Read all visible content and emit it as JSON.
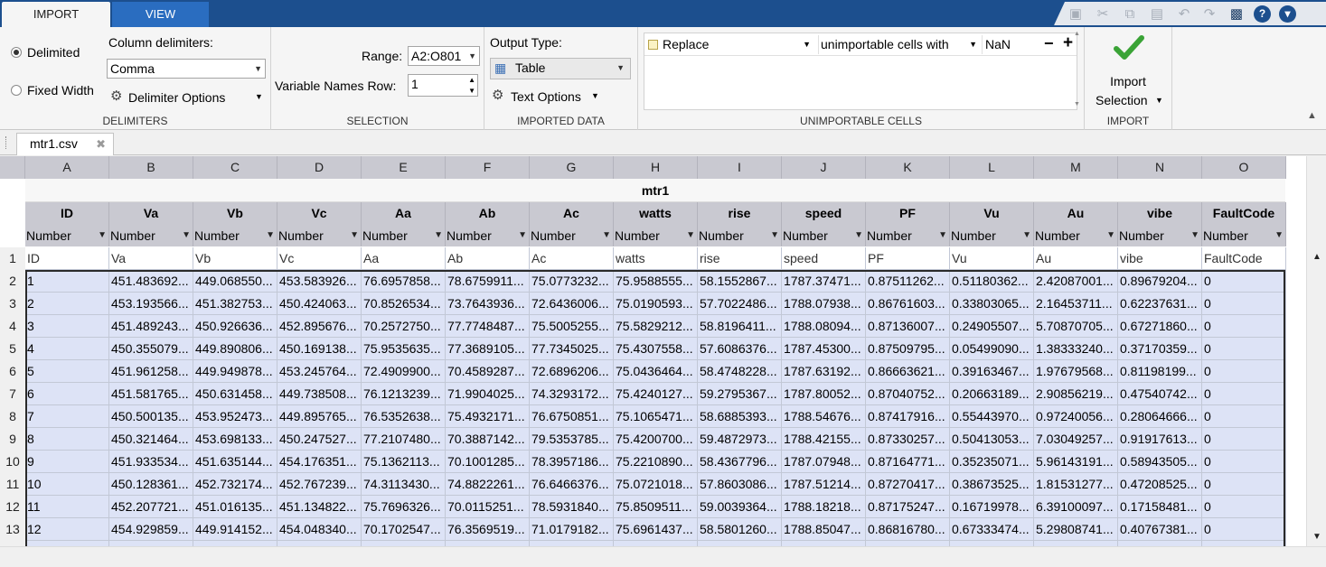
{
  "tabs": {
    "import": "IMPORT",
    "view": "VIEW"
  },
  "delimiters": {
    "delimited": "Delimited",
    "fixed_width": "Fixed Width",
    "column_delimiters_label": "Column delimiters:",
    "column_delimiter_value": "Comma",
    "delimiter_options": "Delimiter Options",
    "section_label": "DELIMITERS"
  },
  "selection": {
    "range_label": "Range:",
    "range_value": "A2:O801",
    "varnames_label": "Variable Names Row:",
    "varnames_value": "1",
    "section_label": "SELECTION"
  },
  "imported_data": {
    "output_type_label": "Output Type:",
    "output_type_value": "Table",
    "text_options": "Text Options",
    "section_label": "IMPORTED DATA"
  },
  "unimportable": {
    "rule_action": "Replace",
    "rule_target": "unimportable cells with",
    "rule_value": "NaN",
    "minus": "−",
    "plus": "+",
    "section_label": "UNIMPORTABLE CELLS"
  },
  "import_section": {
    "import_label": "Import",
    "selection_label": "Selection",
    "section_label": "IMPORT"
  },
  "doc_tab": {
    "label": "mtr1.csv"
  },
  "grid": {
    "column_letters": [
      "A",
      "B",
      "C",
      "D",
      "E",
      "F",
      "G",
      "H",
      "I",
      "J",
      "K",
      "L",
      "M",
      "N",
      "O"
    ],
    "table_name": "mtr1",
    "variable_names": [
      "ID",
      "Va",
      "Vb",
      "Vc",
      "Aa",
      "Ab",
      "Ac",
      "watts",
      "rise",
      "speed",
      "PF",
      "Vu",
      "Au",
      "vibe",
      "FaultCode"
    ],
    "type_label": "Number",
    "header_row": [
      "ID",
      "Va",
      "Vb",
      "Vc",
      "Aa",
      "Ab",
      "Ac",
      "watts",
      "rise",
      "speed",
      "PF",
      "Vu",
      "Au",
      "vibe",
      "FaultCode"
    ],
    "rows": [
      [
        "1",
        "451.483692...",
        "449.068550...",
        "453.583926...",
        "76.6957858...",
        "78.6759911...",
        "75.0773232...",
        "75.9588555...",
        "58.1552867...",
        "1787.37471...",
        "0.87511262...",
        "0.51180362...",
        "2.42087001...",
        "0.89679204...",
        "0"
      ],
      [
        "2",
        "453.193566...",
        "451.382753...",
        "450.424063...",
        "70.8526534...",
        "73.7643936...",
        "72.6436006...",
        "75.0190593...",
        "57.7022486...",
        "1788.07938...",
        "0.86761603...",
        "0.33803065...",
        "2.16453711...",
        "0.62237631...",
        "0"
      ],
      [
        "3",
        "451.489243...",
        "450.926636...",
        "452.895676...",
        "70.2572750...",
        "77.7748487...",
        "75.5005255...",
        "75.5829212...",
        "58.8196411...",
        "1788.08094...",
        "0.87136007...",
        "0.24905507...",
        "5.70870705...",
        "0.67271860...",
        "0"
      ],
      [
        "4",
        "450.355079...",
        "449.890806...",
        "450.169138...",
        "75.9535635...",
        "77.3689105...",
        "77.7345025...",
        "75.4307558...",
        "57.6086376...",
        "1787.45300...",
        "0.87509795...",
        "0.05499090...",
        "1.38333240...",
        "0.37170359...",
        "0"
      ],
      [
        "5",
        "451.961258...",
        "449.949878...",
        "453.245764...",
        "72.4909900...",
        "70.4589287...",
        "72.6896206...",
        "75.0436464...",
        "58.4748228...",
        "1787.63192...",
        "0.86663621...",
        "0.39163467...",
        "1.97679568...",
        "0.81198199...",
        "0"
      ],
      [
        "6",
        "451.581765...",
        "450.631458...",
        "449.738508...",
        "76.1213239...",
        "71.9904025...",
        "74.3293172...",
        "75.4240127...",
        "59.2795367...",
        "1787.80052...",
        "0.87040752...",
        "0.20663189...",
        "2.90856219...",
        "0.47540742...",
        "0"
      ],
      [
        "7",
        "450.500135...",
        "453.952473...",
        "449.895765...",
        "76.5352638...",
        "75.4932171...",
        "76.6750851...",
        "75.1065471...",
        "58.6885393...",
        "1788.54676...",
        "0.87417916...",
        "0.55443970...",
        "0.97240056...",
        "0.28064666...",
        "0"
      ],
      [
        "8",
        "450.321464...",
        "453.698133...",
        "450.247527...",
        "77.2107480...",
        "70.3887142...",
        "79.5353785...",
        "75.4200700...",
        "59.4872973...",
        "1788.42155...",
        "0.87330257...",
        "0.50413053...",
        "7.03049257...",
        "0.91917613...",
        "0"
      ],
      [
        "9",
        "451.933534...",
        "451.635144...",
        "454.176351...",
        "75.1362113...",
        "70.1001285...",
        "78.3957186...",
        "75.2210890...",
        "58.4367796...",
        "1787.07948...",
        "0.87164771...",
        "0.35235071...",
        "5.96143191...",
        "0.58943505...",
        "0"
      ],
      [
        "10",
        "450.128361...",
        "452.732174...",
        "452.767239...",
        "74.3113430...",
        "74.8822261...",
        "76.6466376...",
        "75.0721018...",
        "57.8603086...",
        "1787.51214...",
        "0.87270417...",
        "0.38673525...",
        "1.81531277...",
        "0.47208525...",
        "0"
      ],
      [
        "11",
        "452.207721...",
        "451.016135...",
        "451.134822...",
        "75.7696326...",
        "70.0115251...",
        "78.5931840...",
        "75.8509511...",
        "59.0039364...",
        "1788.18218...",
        "0.87175247...",
        "0.16719978...",
        "6.39100097...",
        "0.17158481...",
        "0"
      ],
      [
        "12",
        "454.929859...",
        "449.914152...",
        "454.048340...",
        "70.1702547...",
        "76.3569519...",
        "71.0179182...",
        "75.6961437...",
        "58.5801260...",
        "1788.85047...",
        "0.86816780...",
        "0.67333474...",
        "5.29808741...",
        "0.40767381...",
        "0"
      ]
    ],
    "row_numbers": [
      "1",
      "2",
      "3",
      "4",
      "5",
      "6",
      "7",
      "8",
      "9",
      "10",
      "11",
      "12",
      "13"
    ]
  },
  "colors": {
    "title_bar": "#1c4f8e",
    "view_tab": "#2a6dc0",
    "header_gray": "#c9c9d1",
    "selection_fill": "#dde3f6",
    "checkmark_green": "#3aa336"
  }
}
